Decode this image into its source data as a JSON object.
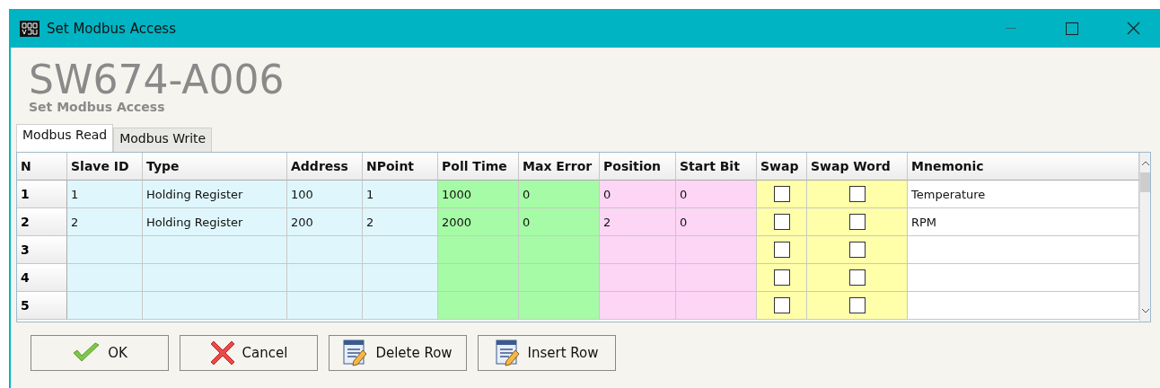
{
  "window": {
    "title": "Set Modbus Access"
  },
  "header": {
    "title": "SW674-A006",
    "subtitle": "Set Modbus Access"
  },
  "tabs": [
    {
      "label": "Modbus Read",
      "selected": true
    },
    {
      "label": "Modbus Write",
      "selected": false
    }
  ],
  "table": {
    "columns": [
      {
        "label": "N",
        "kind": "rownum"
      },
      {
        "label": "Slave ID",
        "kind": "text",
        "color": "#dff7fc"
      },
      {
        "label": "Type",
        "kind": "text",
        "color": "#dff7fc"
      },
      {
        "label": "Address",
        "kind": "text",
        "color": "#dff7fc"
      },
      {
        "label": "NPoint",
        "kind": "text",
        "color": "#dff7fc"
      },
      {
        "label": "Poll Time",
        "kind": "text",
        "color": "#a6fba6"
      },
      {
        "label": "Max Error",
        "kind": "text",
        "color": "#a6fba6"
      },
      {
        "label": "Position",
        "kind": "text",
        "color": "#fdd5f5"
      },
      {
        "label": "Start Bit",
        "kind": "text",
        "color": "#fdd5f5"
      },
      {
        "label": "Swap",
        "kind": "check",
        "color": "#ffffaa"
      },
      {
        "label": "Swap Word",
        "kind": "check",
        "color": "#ffffaa"
      },
      {
        "label": "Mnemonic",
        "kind": "text",
        "color": "#ffffff"
      }
    ],
    "rows": [
      {
        "n": "1",
        "values": [
          "1",
          "Holding Register",
          "100",
          "1",
          "1000",
          "0",
          "0",
          "0",
          "Temperature"
        ],
        "checks": [
          false,
          false
        ]
      },
      {
        "n": "2",
        "values": [
          "2",
          "Holding Register",
          "200",
          "2",
          "2000",
          "0",
          "2",
          "0",
          "RPM"
        ],
        "checks": [
          false,
          false
        ]
      },
      {
        "n": "3",
        "checks": [
          false,
          false
        ]
      },
      {
        "n": "4",
        "checks": [
          false,
          false
        ]
      },
      {
        "n": "5",
        "checks": [
          false,
          false
        ]
      }
    ]
  },
  "buttons": [
    {
      "label": "OK",
      "kind": "ok"
    },
    {
      "label": "Cancel",
      "kind": "cancel"
    },
    {
      "label": "Delete Row",
      "kind": "delete"
    },
    {
      "label": "Insert Row",
      "kind": "insert"
    }
  ]
}
